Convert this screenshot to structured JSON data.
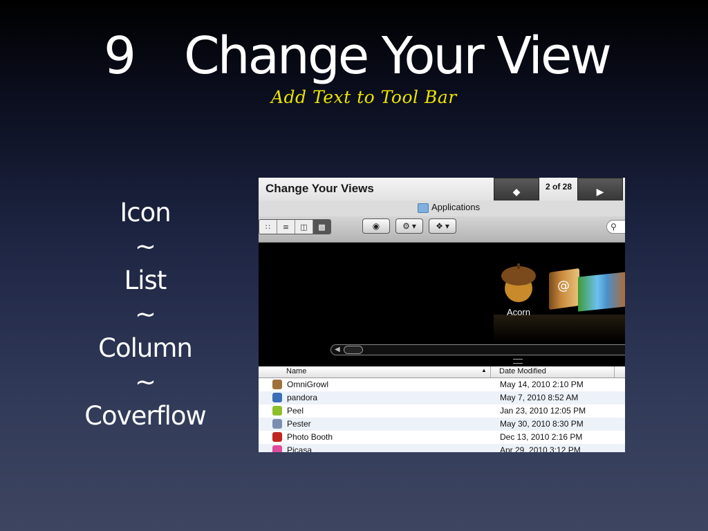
{
  "slide": {
    "number": "9",
    "title": "Change Your View",
    "subtitle": "Add Text to Tool Bar",
    "views": [
      "Icon",
      "~",
      "List",
      "~",
      "Column",
      "~",
      "Coverflow"
    ]
  },
  "screenshot": {
    "window_title": "Change Your Views",
    "page_counter": "2 of 28",
    "path_label": "Applications",
    "search_icon": "magnifier",
    "toolbar_icons": [
      "icon-view",
      "list-view",
      "column-view",
      "coverflow-view",
      "eye-quicklook",
      "gear-action",
      "dropbox"
    ],
    "coverflow_selected": "Acorn",
    "columns": {
      "name": "Name",
      "date": "Date Modified"
    },
    "rows": [
      {
        "name": "OmniGrowl",
        "date": "May 14, 2010 2:10 PM",
        "color": "#a0703a"
      },
      {
        "name": "pandora",
        "date": "May 7, 2010 8:52 AM",
        "color": "#3b6fb8"
      },
      {
        "name": "Peel",
        "date": "Jan 23, 2010 12:05 PM",
        "color": "#8cbf2a"
      },
      {
        "name": "Pester",
        "date": "May 30, 2010 8:30 PM",
        "color": "#7a8fb0"
      },
      {
        "name": "Photo Booth",
        "date": "Dec 13, 2010 2:16 PM",
        "color": "#c0261f"
      },
      {
        "name": "Picasa",
        "date": "Apr 29, 2010 3:12 PM",
        "color": "#e04a9a"
      }
    ]
  }
}
